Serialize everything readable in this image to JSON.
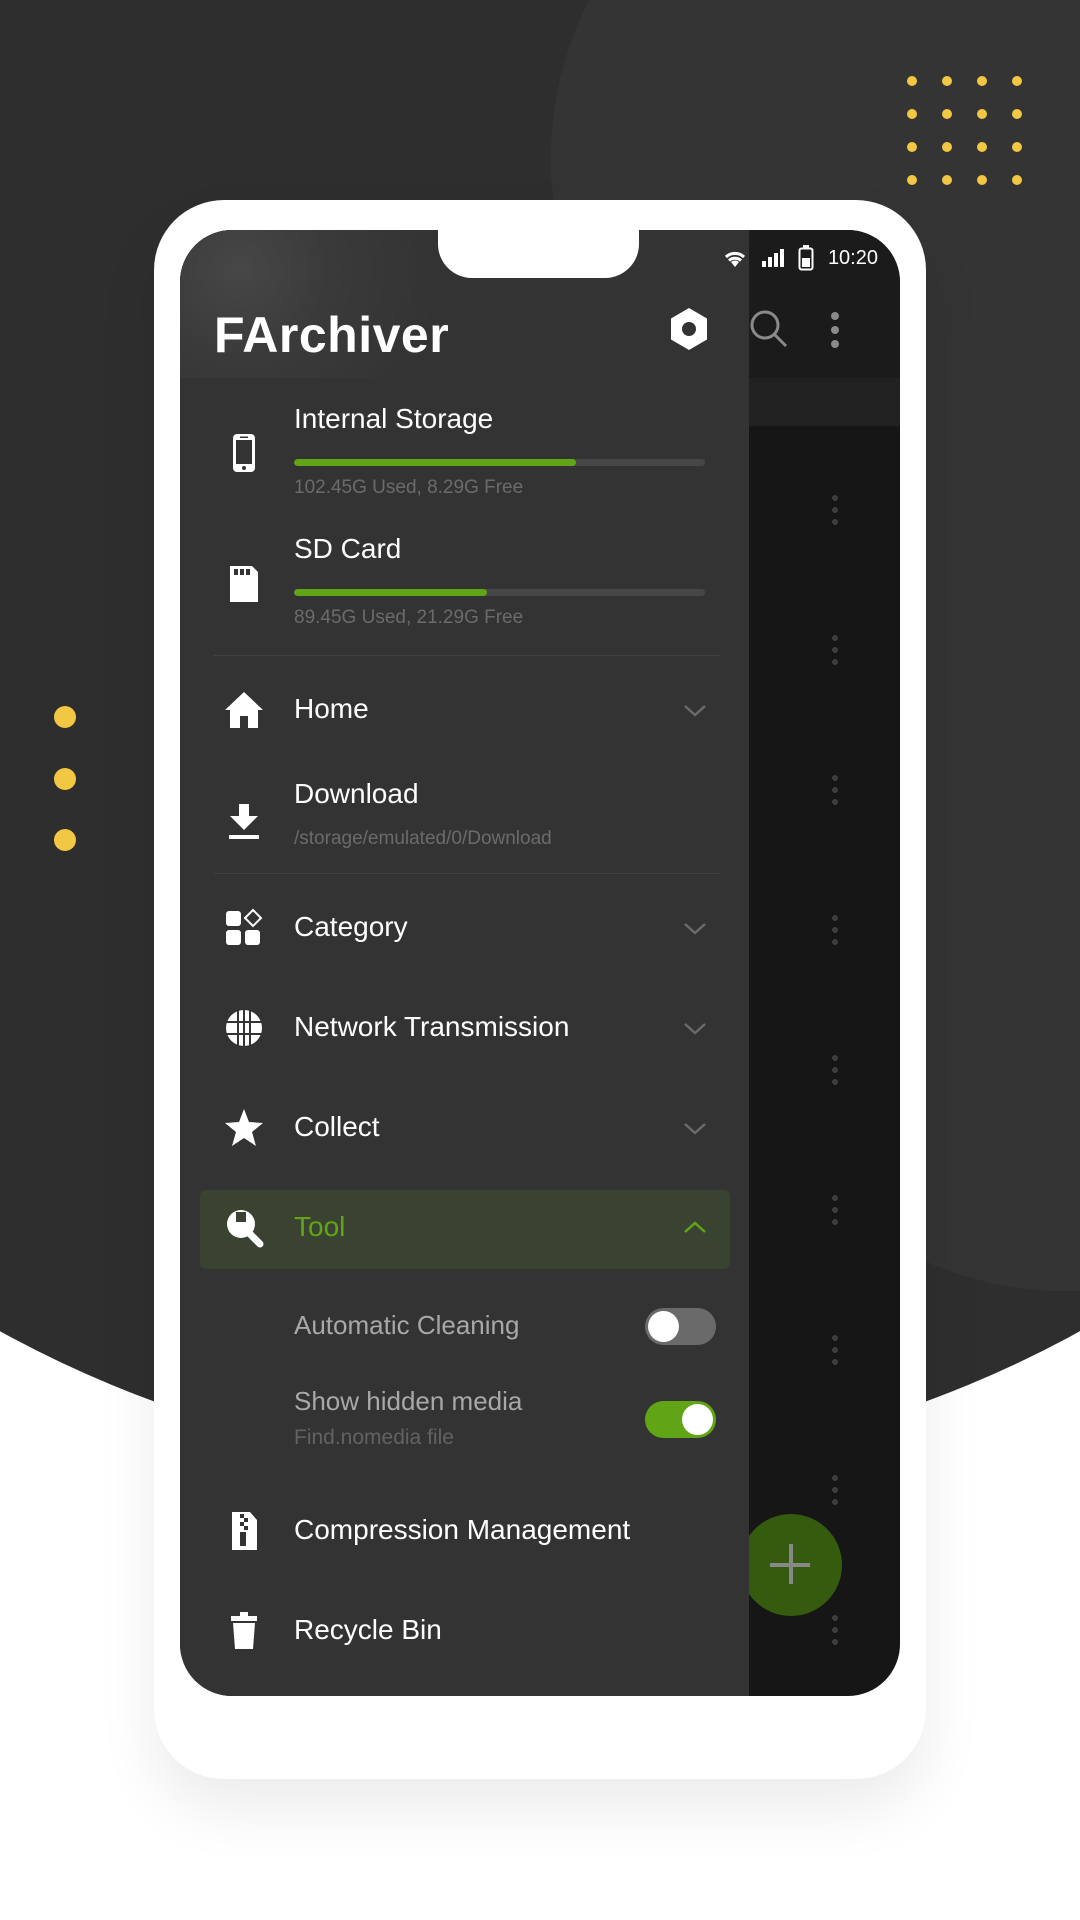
{
  "status_bar": {
    "time": "10:20"
  },
  "header": {
    "title": "FArchiver"
  },
  "storage": [
    {
      "label": "Internal Storage",
      "detail": "102.45G Used,  8.29G Free",
      "used_fraction": 0.685
    },
    {
      "label": "SD Card",
      "detail": "89.45G Used,  21.29G Free",
      "used_fraction": 0.47
    }
  ],
  "menu": {
    "home": "Home",
    "download": {
      "label": "Download",
      "path": "/storage/emulated/0/Download"
    },
    "category": "Category",
    "network": "Network Transmission",
    "collect": "Collect",
    "tool": "Tool",
    "tool_options": [
      {
        "label": "Automatic Cleaning",
        "sub": "",
        "on": false
      },
      {
        "label": "Show hidden media",
        "sub": "Find.nomedia file",
        "on": true
      }
    ],
    "compression": "Compression Management",
    "recycle": "Recycle Bin"
  },
  "colors": {
    "accent": "#61a516",
    "highlight_bg": "#3a4331",
    "decor_yellow": "#f2c744",
    "fab": "#345b0e"
  }
}
